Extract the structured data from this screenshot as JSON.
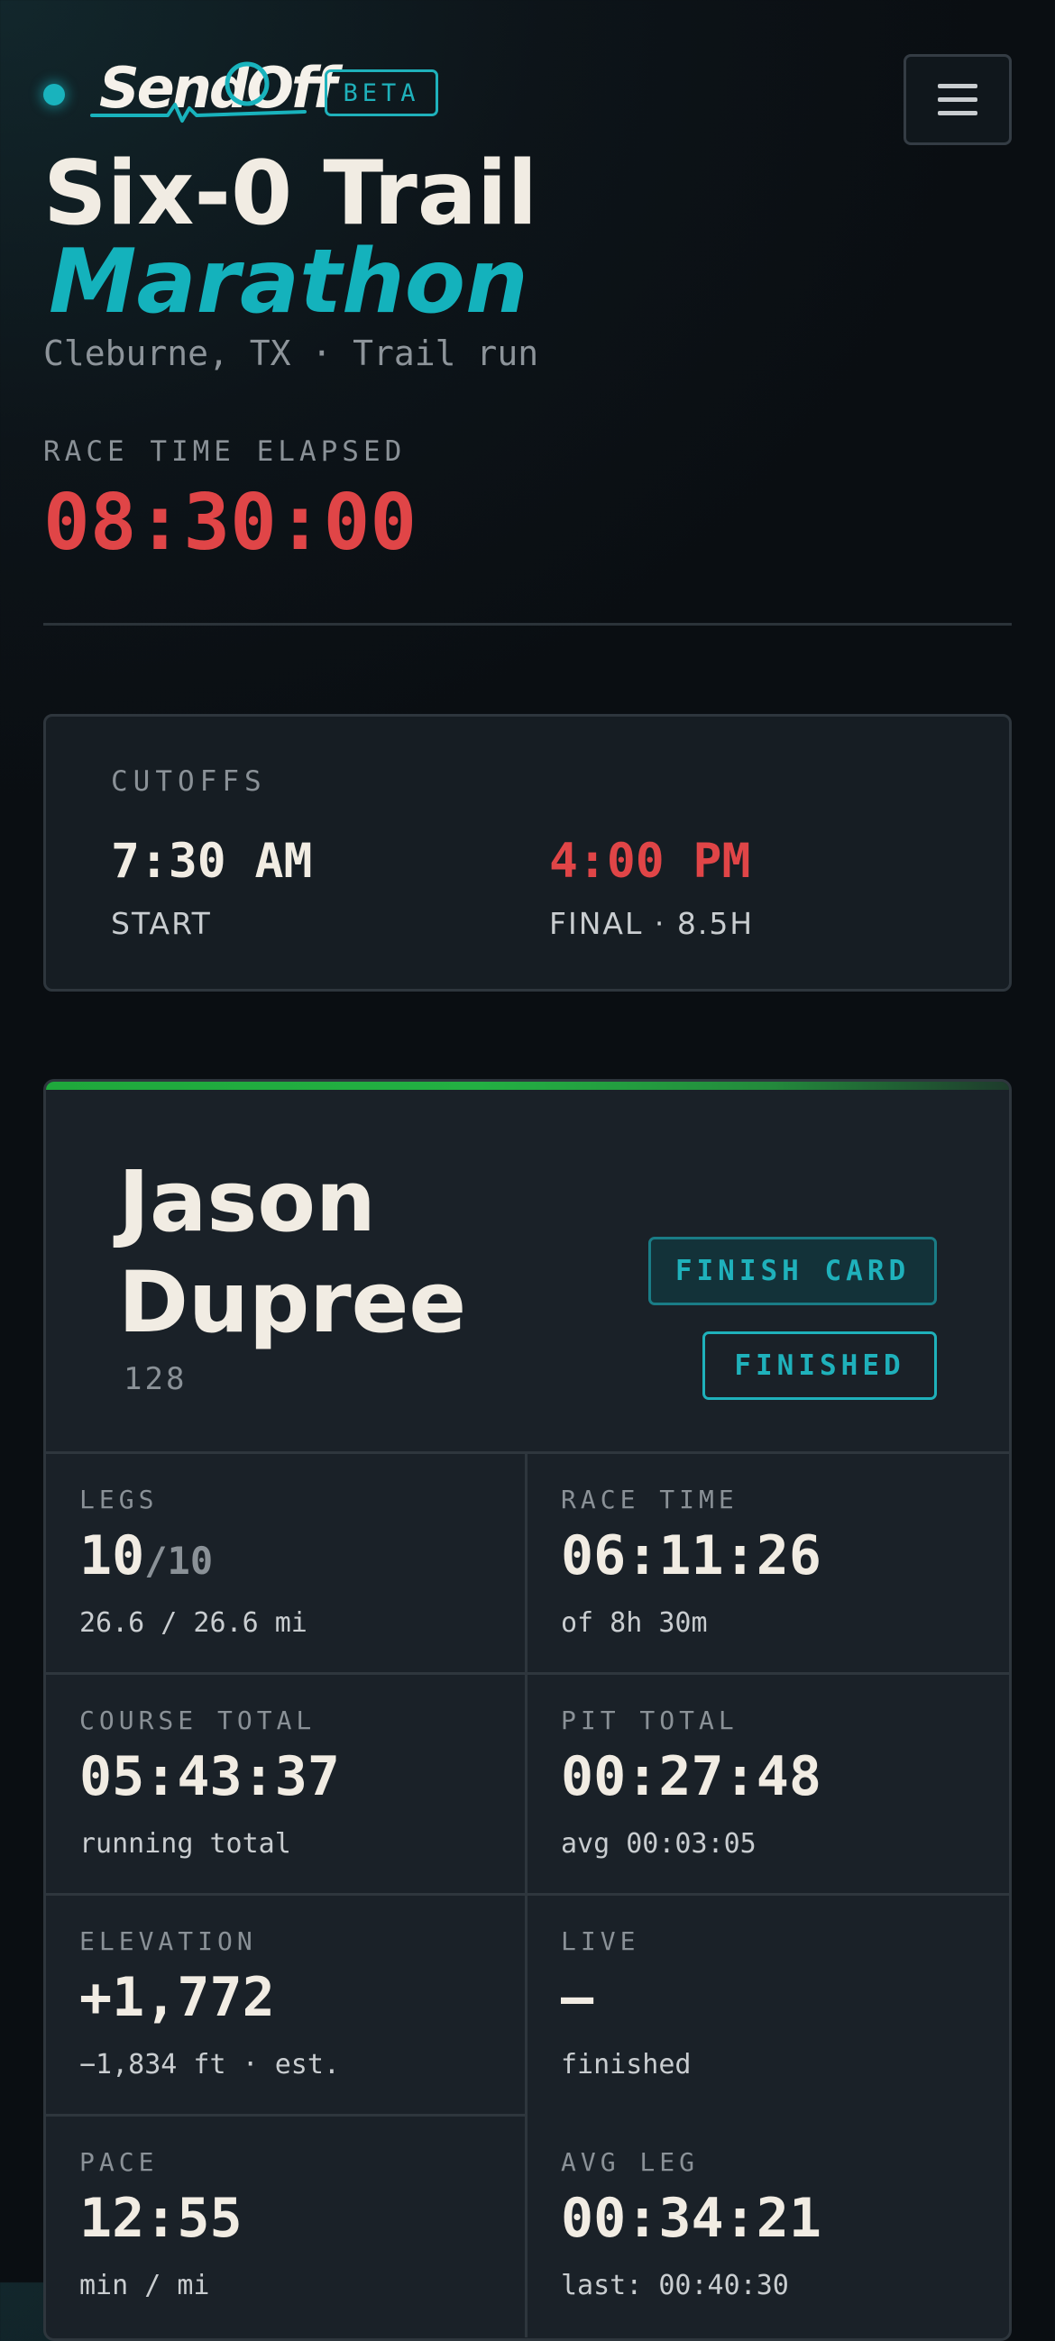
{
  "header": {
    "logo_text": "SendOff",
    "beta_label": "BETA"
  },
  "race": {
    "title_line1": "Six-0 Trail",
    "title_line2": "Marathon",
    "subtitle": "Cleburne, TX · Trail run",
    "elapsed_label": "RACE TIME ELAPSED",
    "elapsed_value": "08:30:00"
  },
  "cutoffs": {
    "label": "CUTOFFS",
    "start_time": "7:30 AM",
    "start_label": "START",
    "final_time": "4:00 PM",
    "final_label": "FINAL · 8.5H"
  },
  "runner": {
    "name": "Jason Dupree",
    "bib": "128",
    "finish_card_label": "FINISH CARD",
    "status": "FINISHED",
    "stats": {
      "legs": {
        "label": "LEGS",
        "value": "10",
        "denominator": "/10",
        "sub": "26.6 / 26.6 mi"
      },
      "race_time": {
        "label": "RACE TIME",
        "value": "06:11:26",
        "sub": "of 8h 30m"
      },
      "course_total": {
        "label": "COURSE TOTAL",
        "value": "05:43:37",
        "sub": "running total"
      },
      "pit_total": {
        "label": "PIT TOTAL",
        "value": "00:27:48",
        "sub": "avg 00:03:05"
      },
      "elevation": {
        "label": "ELEVATION",
        "value": "+1,772",
        "sub": "−1,834 ft · est."
      },
      "live": {
        "label": "LIVE",
        "value": "—",
        "sub": "finished"
      },
      "pace": {
        "label": "PACE",
        "value": "12:55",
        "sub": "min / mi"
      },
      "avg_leg": {
        "label": "AVG LEG",
        "value": "00:34:21",
        "sub": "last: 00:40:30"
      }
    }
  },
  "colors": {
    "accent_teal": "#19b3bd",
    "alert_red": "#e04547",
    "progress_green": "#23b043",
    "background": "#0b1015"
  },
  "icons": {
    "status_dot": "live-dot-icon",
    "menu": "hamburger-menu-icon"
  }
}
